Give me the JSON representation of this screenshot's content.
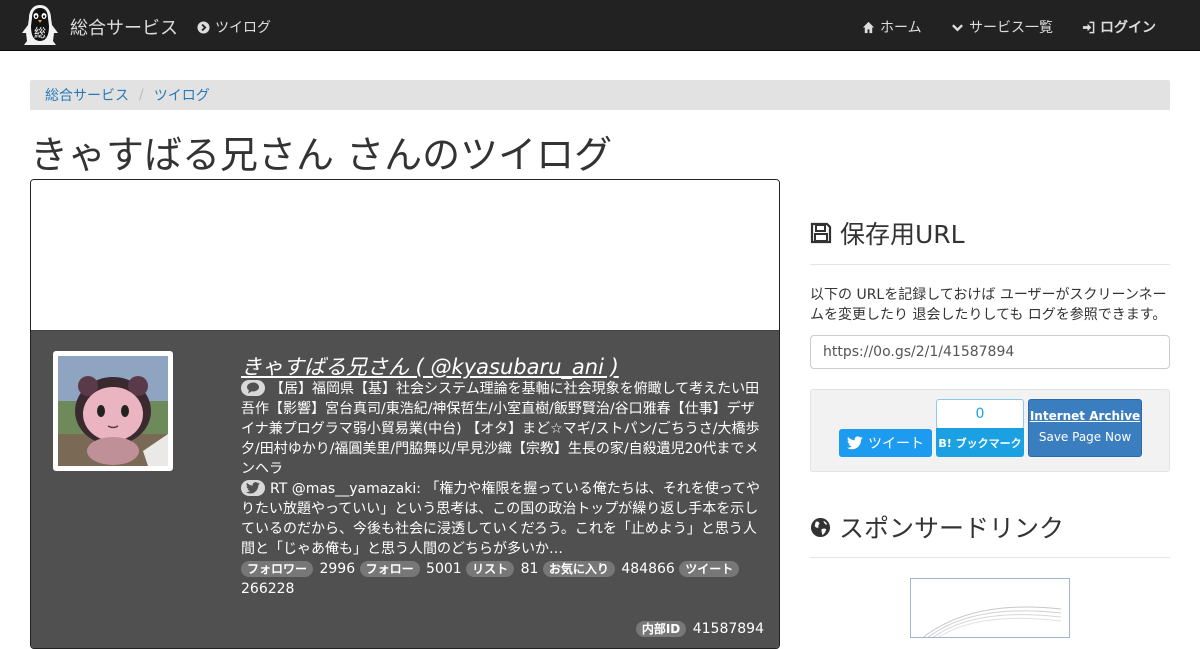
{
  "navbar": {
    "brand": "総合サービス",
    "logo_char": "総",
    "tweetlog_link": "ツイログ",
    "home_link": "ホーム",
    "services_link": "サービス一覧",
    "login_link": "ログイン"
  },
  "breadcrumb": {
    "items": [
      "総合サービス",
      "ツイログ"
    ],
    "separator": "/"
  },
  "page_title": "きゃすばる兄さん さんのツイログ",
  "profile": {
    "name": "きゃすばる兄さん ( @kyasubaru_ani )",
    "bio": "【居】福岡県【基】社会システム理論を基軸に社会現象を俯瞰して考えたい田吾作【影響】宮台真司/東浩紀/神保哲生/小室直樹/飯野賢治/谷口雅春【仕事】デザイナ兼プログラマ弱小貿易業(中台) 【オタ】まど☆マギ/ストパン/ごちうさ/大橋歩夕/田村ゆかり/福圓美里/門脇舞以/早見沙織【宗教】生長の家/自殺遺児20代までメンヘラ",
    "latest_tweet": "RT @mas__yamazaki: 「権力や権限を握っている俺たちは、それを使ってやりたい放題やっていい」という思考は、この国の政治トップが繰り返し手本を示しているのだから、今後も社会に浸透していくだろう。これを「止めよう」と思う人間と「じゃあ俺も」と思う人間のどちらが多いか…",
    "stats": [
      {
        "label": "フォロワー",
        "value": "2996"
      },
      {
        "label": "フォロー",
        "value": "5001"
      },
      {
        "label": "リスト",
        "value": "81"
      },
      {
        "label": "お気に入り",
        "value": "484866"
      },
      {
        "label": "ツイート",
        "value": "266228"
      }
    ],
    "internal_id_label": "内部ID",
    "internal_id": "41587894"
  },
  "save_url": {
    "title": "保存用URL",
    "description": "以下の URLを記録しておけば ユーザーがスクリーンネームを変更したり 退会したりしても ログを参照できます。",
    "url": "https://0o.gs/2/1/41587894"
  },
  "share": {
    "tweet_label": "ツイート",
    "hatena_count": "0",
    "hatena_label": "B! ブックマーク",
    "ia_title": "Internet Archive",
    "ia_action": "Save Page Now"
  },
  "sponsored": {
    "title": "スポンサードリンク"
  },
  "colors": {
    "navbar_bg": "#222222",
    "profile_bg": "#505050",
    "link": "#2a7ab8",
    "twitter": "#1d9bf0",
    "hatena": "#1ba1e2",
    "ia_button": "#3b7ec0"
  },
  "icons": [
    "penguin-logo",
    "chevron-circle-right-icon",
    "home-icon",
    "chevron-down-icon",
    "sign-in-icon",
    "comment-icon",
    "twitter-icon",
    "floppy-disk-icon",
    "globe-icon"
  ]
}
